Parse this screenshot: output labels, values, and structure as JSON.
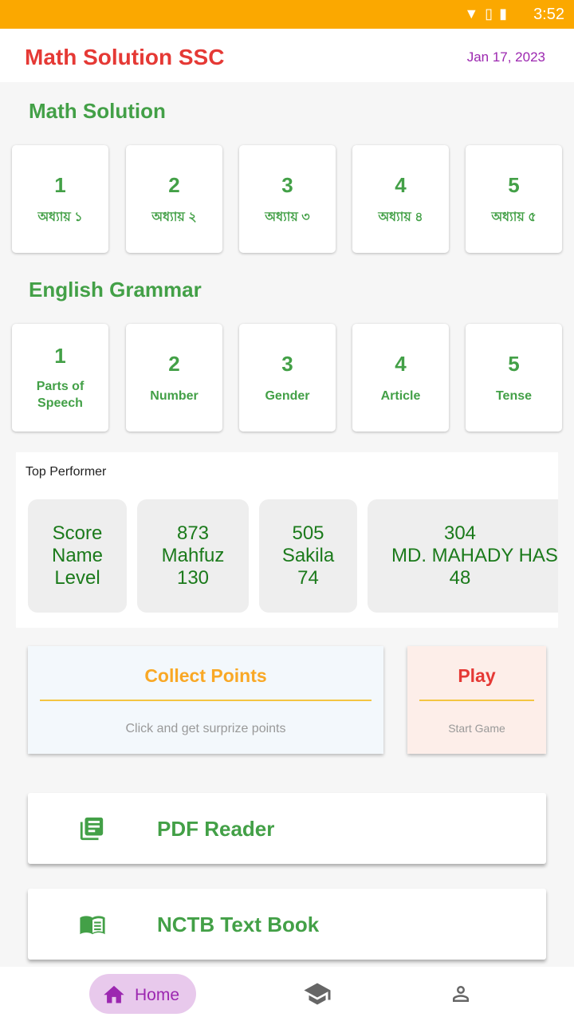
{
  "status": {
    "time": "3:52"
  },
  "appbar": {
    "title": "Math Solution SSC",
    "date": "Jan 17, 2023"
  },
  "math": {
    "title": "Math Solution",
    "items": [
      {
        "num": "1",
        "label": "অধ্যায় ১"
      },
      {
        "num": "2",
        "label": "অধ্যায় ২"
      },
      {
        "num": "3",
        "label": "অধ্যায় ৩"
      },
      {
        "num": "4",
        "label": "অধ্যায় ৪"
      },
      {
        "num": "5",
        "label": "অধ্যায় ৫"
      }
    ]
  },
  "grammar": {
    "title": "English Grammar",
    "items": [
      {
        "num": "1",
        "label": "Parts of Speech"
      },
      {
        "num": "2",
        "label": "Number"
      },
      {
        "num": "3",
        "label": "Gender"
      },
      {
        "num": "4",
        "label": "Article"
      },
      {
        "num": "5",
        "label": "Tense"
      }
    ]
  },
  "top": {
    "title": "Top Performer",
    "header": [
      "Score",
      "Name",
      "Level"
    ],
    "rows": [
      [
        "873",
        "Mahfuz",
        "130"
      ],
      [
        "505",
        "Sakila",
        "74"
      ],
      [
        "304",
        "MD. MAHADY HASAN",
        "48"
      ]
    ]
  },
  "collect": {
    "title": "Collect Points",
    "sub": "Click and get surprize points"
  },
  "play": {
    "title": "Play",
    "sub": "Start Game"
  },
  "links": [
    {
      "label": "PDF Reader",
      "icon": "newspaper-icon"
    },
    {
      "label": "NCTB Text Book",
      "icon": "book-icon"
    }
  ],
  "nav": {
    "home": "Home",
    "colors": {
      "active": "#9c27b0",
      "accent": "#43a047"
    }
  }
}
